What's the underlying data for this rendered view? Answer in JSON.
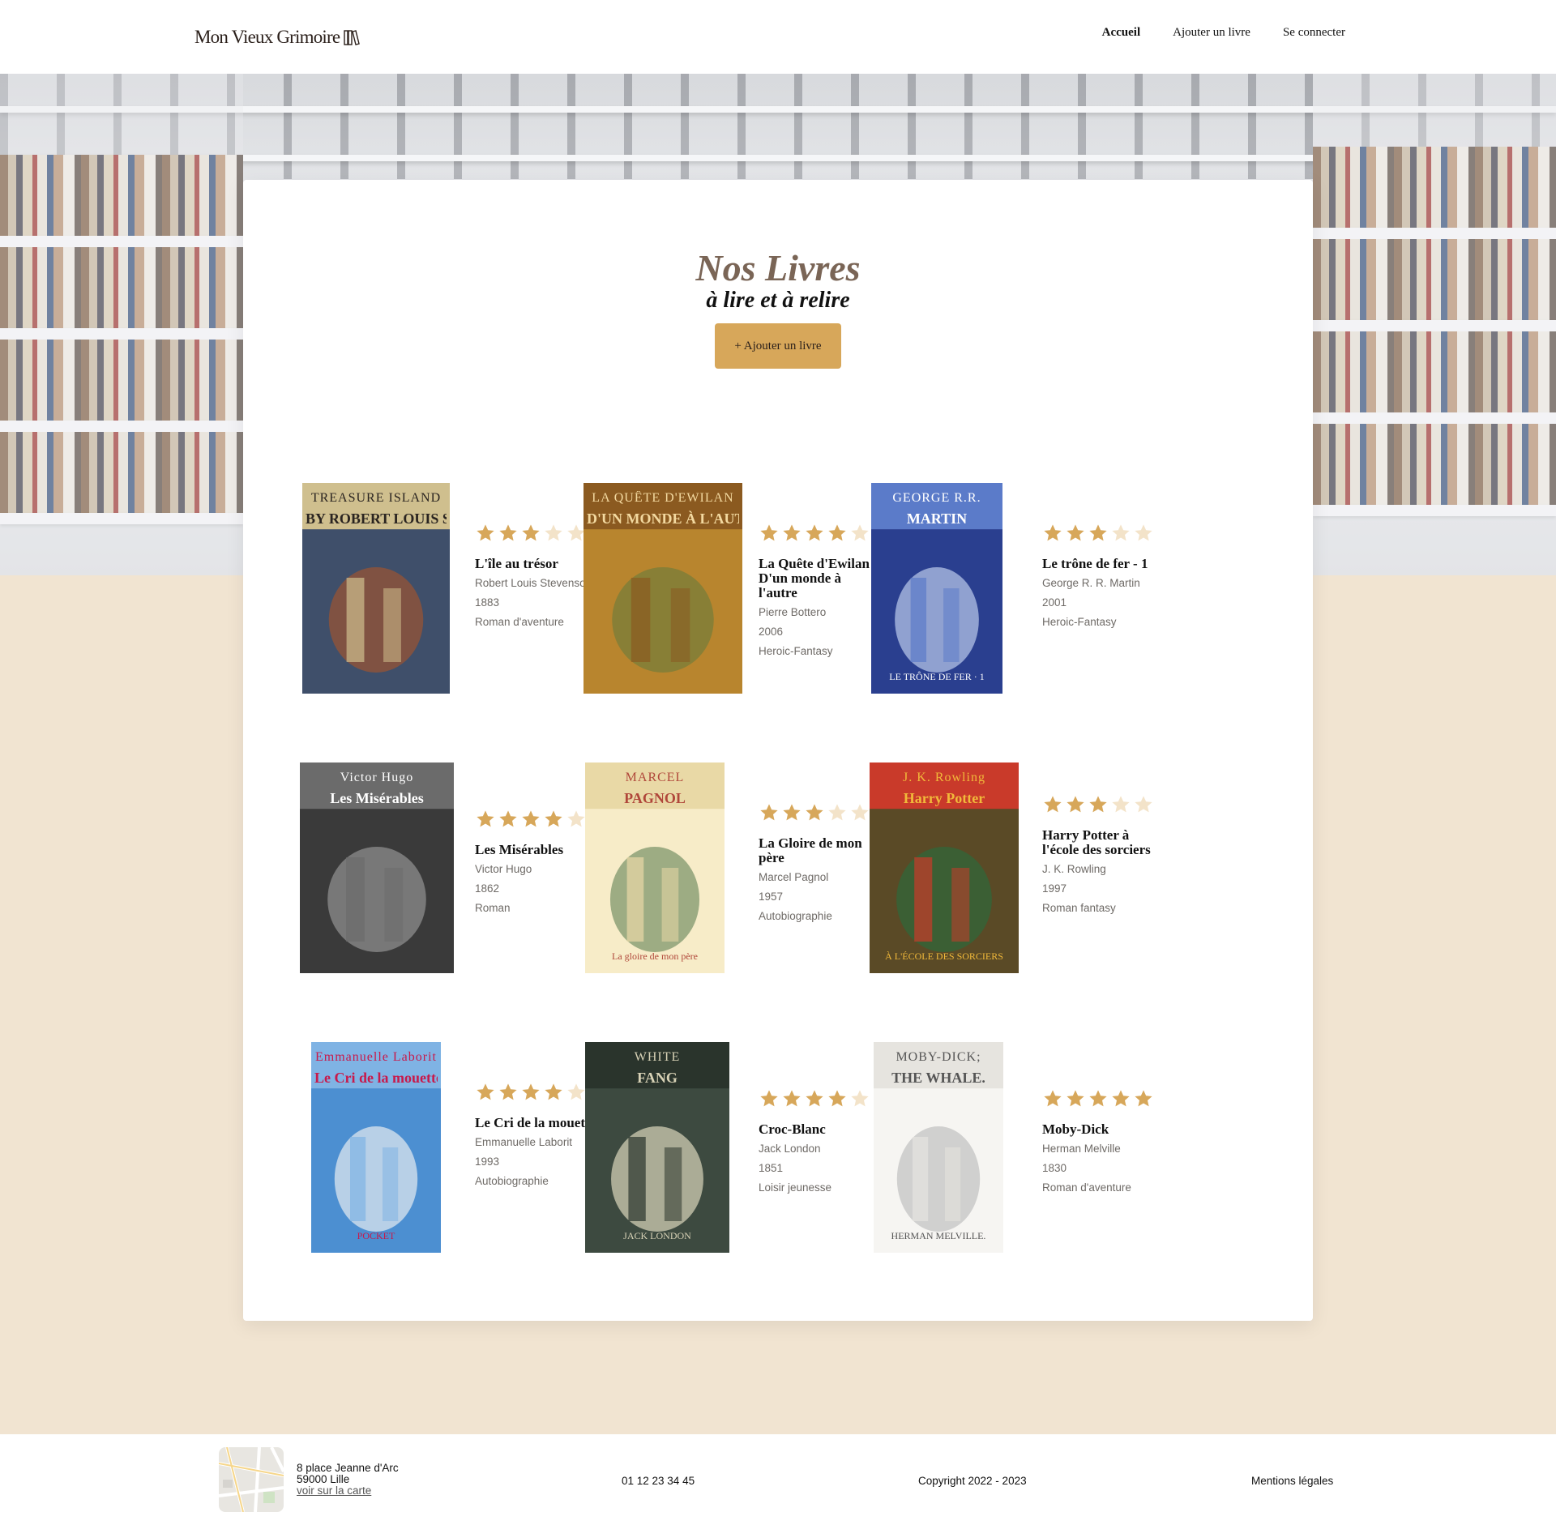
{
  "header": {
    "logo_text": "Mon Vieux Grimoire",
    "nav": [
      {
        "label": "Accueil",
        "active": true
      },
      {
        "label": "Ajouter un livre",
        "active": false
      },
      {
        "label": "Se connecter",
        "active": false
      }
    ]
  },
  "main": {
    "title": "Nos Livres",
    "subtitle": "à lire et à relire",
    "add_button": "+ Ajouter un livre"
  },
  "colors": {
    "accent": "#d7a75a",
    "star_filled": "#d7a75a",
    "star_empty": "#f3e3c9",
    "page_background": "#f1e4d1"
  },
  "books": [
    {
      "title": "L'île au trésor",
      "author": "Robert Louis Stevenson",
      "year": "1883",
      "genre": "Roman d'aventure",
      "rating": 3,
      "cover": {
        "top_text": "TREASURE ISLAND",
        "sub_text": "BY ROBERT LOUIS STEVENSON",
        "bottom_text": ""
      }
    },
    {
      "title": "La Quête d'Ewilan - D'un monde à l'autre",
      "author": "Pierre Bottero",
      "year": "2006",
      "genre": "Heroic-Fantasy",
      "rating": 4,
      "cover": {
        "top_text": "LA QUÊTE D'EWILAN",
        "sub_text": "D'UN MONDE À L'AUTRE",
        "bottom_text": ""
      }
    },
    {
      "title": "Le trône de fer - 1",
      "author": "George R. R. Martin",
      "year": "2001",
      "genre": "Heroic-Fantasy",
      "rating": 3,
      "cover": {
        "top_text": "GEORGE R.R.",
        "sub_text": "MARTIN",
        "bottom_text": "LE TRÔNE DE FER · 1"
      }
    },
    {
      "title": "Les Misérables",
      "author": "Victor Hugo",
      "year": "1862",
      "genre": "Roman",
      "rating": 4,
      "cover": {
        "top_text": "Victor Hugo",
        "sub_text": "Les Misérables",
        "bottom_text": ""
      }
    },
    {
      "title": "La Gloire de mon père",
      "author": "Marcel Pagnol",
      "year": "1957",
      "genre": "Autobiographie",
      "rating": 3,
      "cover": {
        "top_text": "MARCEL",
        "sub_text": "PAGNOL",
        "bottom_text": "La gloire de mon père"
      }
    },
    {
      "title": "Harry Potter à l'école des sorciers",
      "author": "J. K. Rowling",
      "year": "1997",
      "genre": "Roman fantasy",
      "rating": 3,
      "cover": {
        "top_text": "J. K. Rowling",
        "sub_text": "Harry Potter",
        "bottom_text": "À L'ÉCOLE DES SORCIERS"
      }
    },
    {
      "title": "Le Cri de la mouette",
      "author": "Emmanuelle Laborit",
      "year": "1993",
      "genre": "Autobiographie",
      "rating": 4,
      "cover": {
        "top_text": "Emmanuelle Laborit",
        "sub_text": "Le Cri de la mouette",
        "bottom_text": "POCKET"
      }
    },
    {
      "title": "Croc-Blanc",
      "author": "Jack London",
      "year": "1851",
      "genre": "Loisir jeunesse",
      "rating": 4,
      "cover": {
        "top_text": "WHITE",
        "sub_text": "FANG",
        "bottom_text": "JACK LONDON"
      }
    },
    {
      "title": "Moby-Dick",
      "author": "Herman Melville",
      "year": "1830",
      "genre": "Roman d'aventure",
      "rating": 5,
      "cover": {
        "top_text": "MOBY-DICK;",
        "sub_text": "THE WHALE.",
        "bottom_text": "HERMAN MELVILLE."
      }
    }
  ],
  "footer": {
    "address_line1": "8 place Jeanne d'Arc",
    "address_line2": "59000 Lille",
    "map_link": "voir sur la carte",
    "phone": "01 12 23 34 45",
    "copyright": "Copyright 2022 - 2023",
    "legal": "Mentions légales"
  }
}
